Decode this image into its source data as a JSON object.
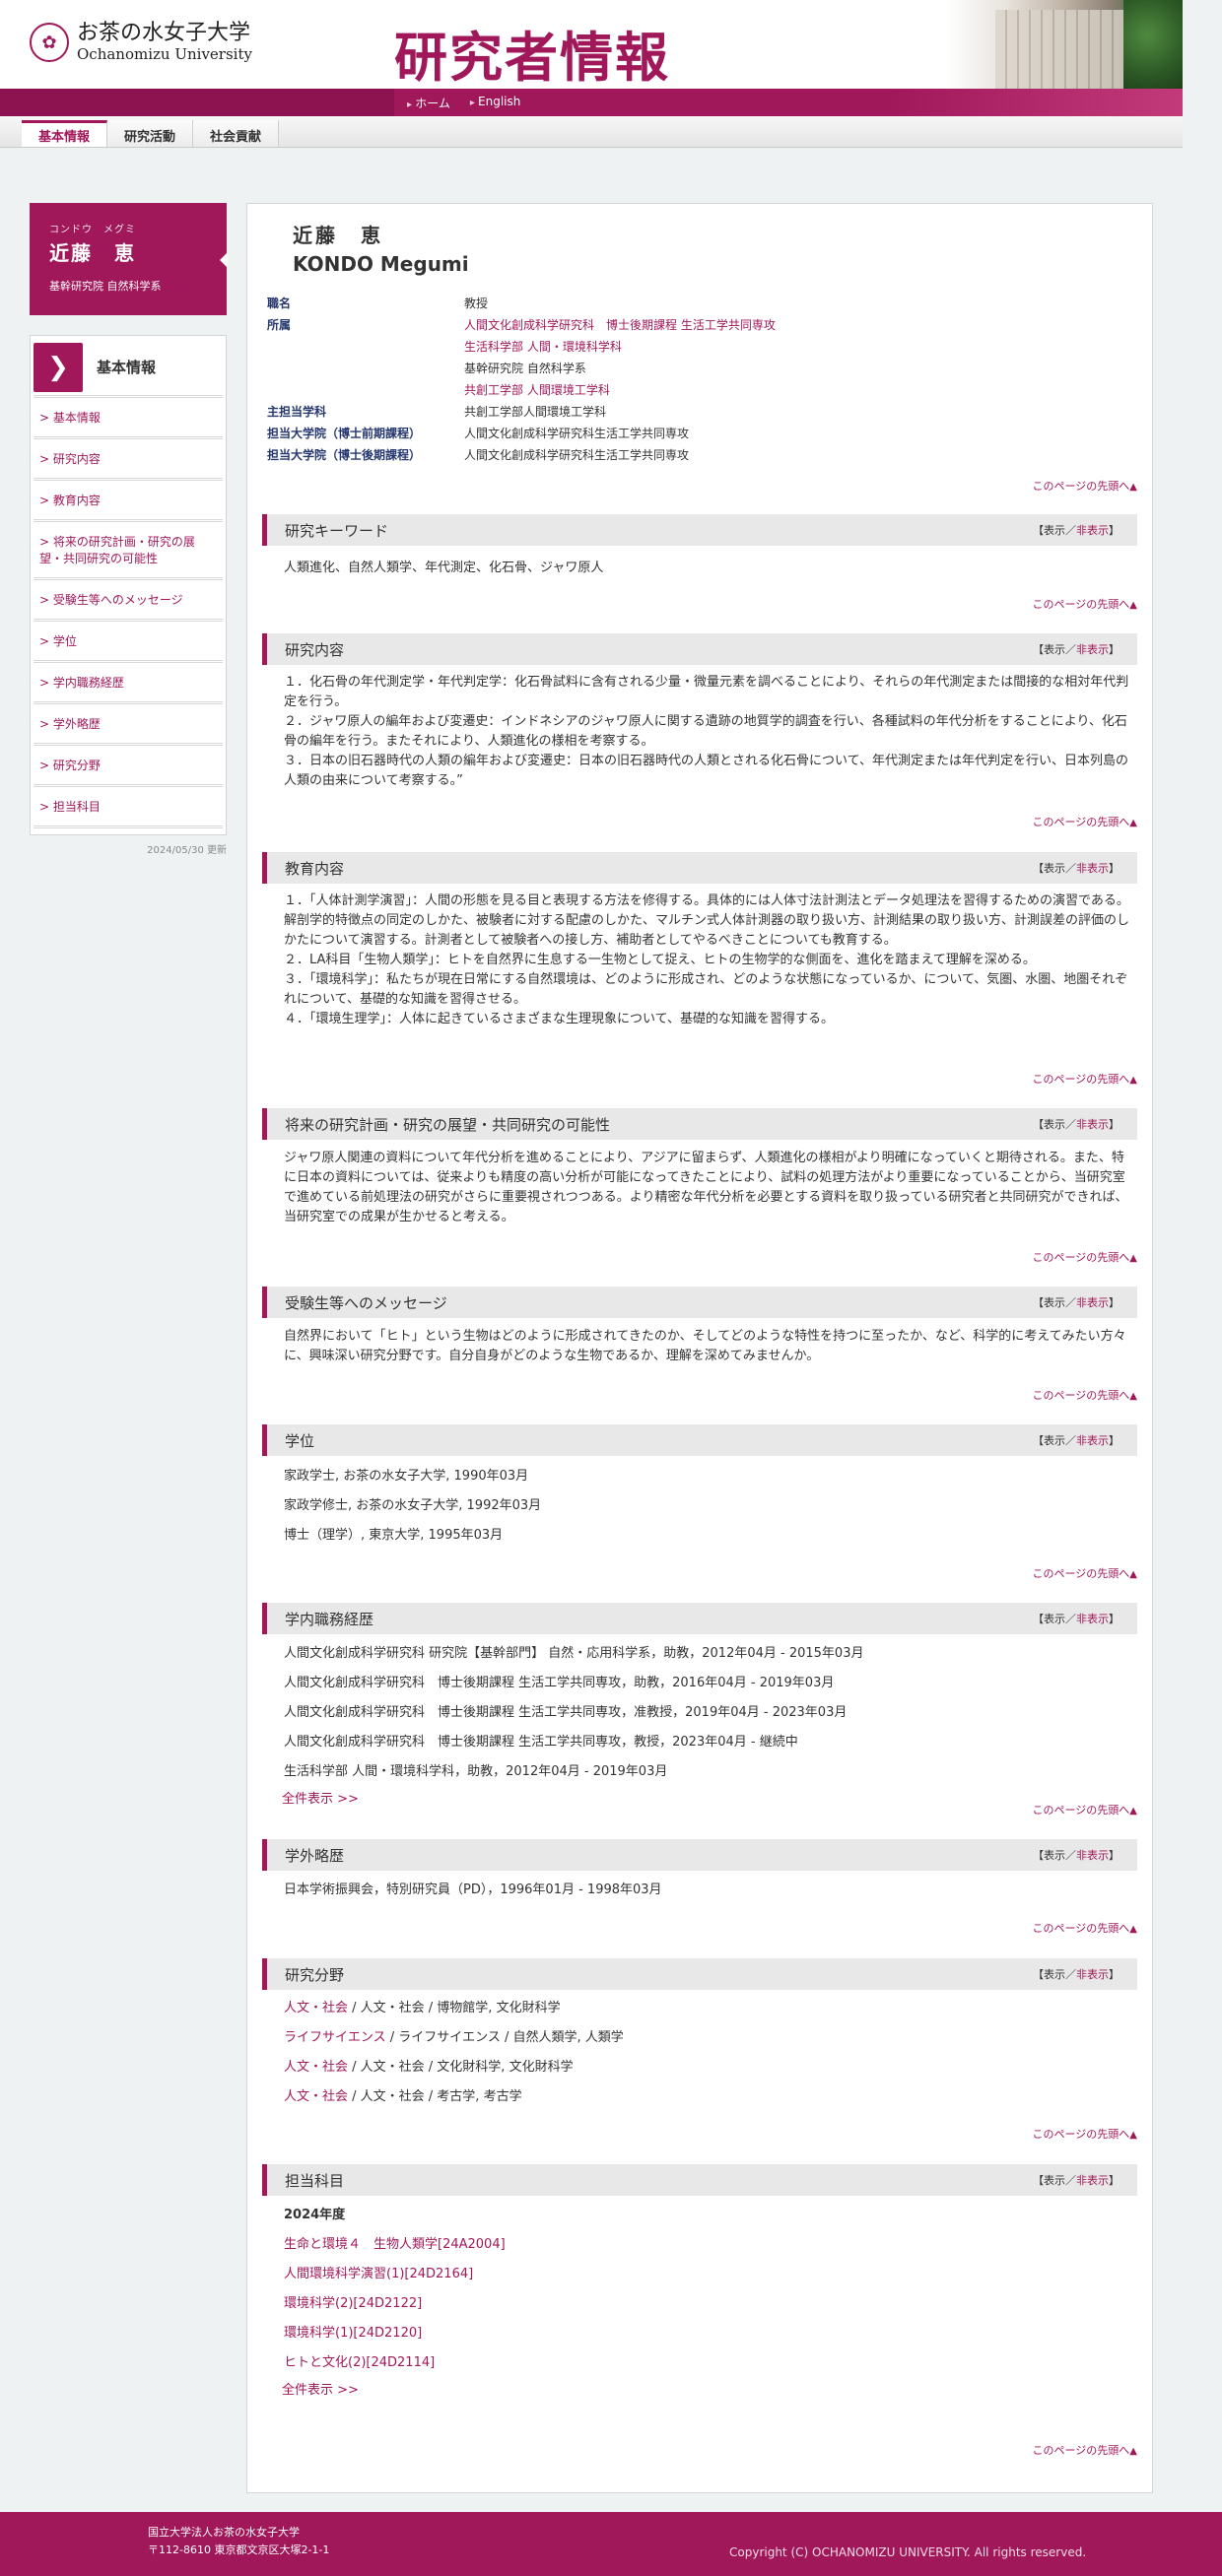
{
  "header": {
    "logo_jp": "お茶の水女子大学",
    "logo_en": "Ochanomizu University",
    "site_title": "研究者情報"
  },
  "nav": {
    "home": "ホーム",
    "english": "English"
  },
  "tabs": [
    "基本情報",
    "研究活動",
    "社会貢献"
  ],
  "profile": {
    "kana": "コンドウ　メグミ",
    "name": "近藤　恵",
    "affil": "基幹研究院 自然科学系"
  },
  "sidenav": {
    "title": "基本情報",
    "items": [
      "基本情報",
      "研究内容",
      "教育内容",
      "将来の研究計画・研究の展望・共同研究の可能性",
      "受験生等へのメッセージ",
      "学位",
      "学内職務経歴",
      "学外略歴",
      "研究分野",
      "担当科目"
    ]
  },
  "updated": "2024/05/30 更新",
  "person": {
    "name_jp": "近藤　恵",
    "name_en": "KONDO Megumi"
  },
  "info": {
    "title_label": "職名",
    "title_value": "教授",
    "affil_label": "所属",
    "affil_1": "人間文化創成科学研究科　博士後期課程 生活工学共同専攻",
    "affil_2": "生活科学部 人間・環境科学科",
    "affil_3": "基幹研究院 自然科学系",
    "affil_4": "共創工学部 人間環境工学科",
    "dept_label": "主担当学科",
    "dept_value": "共創工学部人間環境工学科",
    "master_label": "担当大学院（博士前期課程）",
    "master_value": "人間文化創成科学研究科生活工学共同専攻",
    "doctor_label": "担当大学院（博士後期課程）",
    "doctor_value": "人間文化創成科学研究科生活工学共同専攻"
  },
  "totop": "このページの先頭へ",
  "toggle": {
    "show": "表示",
    "sep": "／",
    "hide": "非表示"
  },
  "sections": {
    "keywords": {
      "title": "研究キーワード",
      "text": "人類進化、自然人類学、年代測定、化石骨、ジャワ原人"
    },
    "research": {
      "title": "研究内容",
      "text": "１．化石骨の年代測定学・年代判定学：化石骨試料に含有される少量・微量元素を調べることにより、それらの年代測定または間接的な相対年代判定を行う。\n２．ジャワ原人の編年および変遷史：インドネシアのジャワ原人に関する遺跡の地質学的調査を行い、各種試料の年代分析をすることにより、化石骨の編年を行う。またそれにより、人類進化の様相を考察する。\n３．日本の旧石器時代の人類の編年および変遷史：日本の旧石器時代の人類とされる化石骨について、年代測定または年代判定を行い、日本列島の人類の由来について考察する。”"
    },
    "education": {
      "title": "教育内容",
      "text": "１．「人体計測学演習」：人間の形態を見る目と表現する方法を修得する。具体的には人体寸法計測法とデータ処理法を習得するための演習である。解剖学的特徴点の同定のしかた、被験者に対する配慮のしかた、マルチン式人体計測器の取り扱い方、計測結果の取り扱い方、計測誤差の評価のしかたについて演習する。計測者として被験者への接し方、補助者としてやるべきことについても教育する。\n２．LA科目「生物人類学」：ヒトを自然界に生息する一生物として捉え、ヒトの生物学的な側面を、進化を踏まえて理解を深める。\n３．「環境科学」：私たちが現在日常にする自然環境は、どのように形成され、どのような状態になっているか、について、気圏、水圏、地圏それぞれについて、基礎的な知識を習得させる。\n４．「環境生理学」：人体に起きているさまざまな生理現象について、基礎的な知識を習得する。"
    },
    "future": {
      "title": "将来の研究計画・研究の展望・共同研究の可能性",
      "text": "ジャワ原人関連の資料について年代分析を進めることにより、アジアに留まらず、人類進化の様相がより明確になっていくと期待される。また、特に日本の資料については、従来よりも精度の高い分析が可能になってきたことにより、試料の処理方法がより重要になっていることから、当研究室で進めている前処理法の研究がさらに重要視されつつある。より精密な年代分析を必要とする資料を取り扱っている研究者と共同研究ができれば、当研究室での成果が生かせると考える。"
    },
    "message": {
      "title": "受験生等へのメッセージ",
      "text": "自然界において「ヒト」という生物はどのように形成されてきたのか、そしてどのような特性を持つに至ったか、など、科学的に考えてみたい方々に、興味深い研究分野です。自分自身がどのような生物であるか、理解を深めてみませんか。"
    },
    "degree": {
      "title": "学位",
      "items": [
        "家政学士, お茶の水女子大学, 1990年03月",
        "家政学修士, お茶の水女子大学, 1992年03月",
        "博士（理学）, 東京大学, 1995年03月"
      ]
    },
    "career_in": {
      "title": "学内職務経歴",
      "items": [
        "人間文化創成科学研究科 研究院【基幹部門】 自然・応用科学系，助教，2012年04月 - 2015年03月",
        "人間文化創成科学研究科　博士後期課程 生活工学共同専攻，助教，2016年04月 - 2019年03月",
        "人間文化創成科学研究科　博士後期課程 生活工学共同専攻，准教授，2019年04月 - 2023年03月",
        "人間文化創成科学研究科　博士後期課程 生活工学共同専攻，教授，2023年04月 - 継続中",
        "生活科学部 人間・環境科学科，助教，2012年04月 - 2019年03月"
      ],
      "more": "全件表示 >>"
    },
    "career_out": {
      "title": "学外略歴",
      "items": [
        "日本学術振興会，特別研究員（PD），1996年01月 - 1998年03月"
      ]
    },
    "fields": {
      "title": "研究分野",
      "items": [
        {
          "link": "人文・社会",
          "rest": " / 人文・社会 / 博物館学, 文化財科学"
        },
        {
          "link": "ライフサイエンス",
          "rest": " / ライフサイエンス / 自然人類学, 人類学"
        },
        {
          "link": "人文・社会",
          "rest": " / 人文・社会 / 文化財科学, 文化財科学"
        },
        {
          "link": "人文・社会",
          "rest": " / 人文・社会 / 考古学, 考古学"
        }
      ]
    },
    "courses": {
      "title": "担当科目",
      "year": "2024年度",
      "items": [
        "生命と環境４　生物人類学[24A2004]",
        "人間環境科学演習(1)[24D2164]",
        "環境科学(2)[24D2122]",
        "環境科学(1)[24D2120]",
        "ヒトと文化(2)[24D2114]"
      ],
      "more": "全件表示 >>"
    }
  },
  "footer": {
    "org": "国立大学法人お茶の水女子大学",
    "addr": "〒112-8610 東京都文京区大塚2-1-1",
    "copy": "Copyright (C) OCHANOMIZU UNIVERSITY. All rights reserved."
  }
}
